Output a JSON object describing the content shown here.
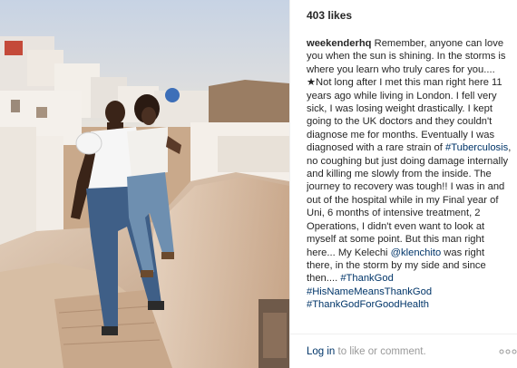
{
  "post": {
    "likes": "403 likes",
    "caption": {
      "username": "weekenderhq",
      "text_part1": "Remember, anyone can love you when the sun is shining. In the storms is where you learn who truly cares for you.... ",
      "star_glyph": "★",
      "text_part2": "Not long after I met this man right here 11 years ago while living in London. I fell very sick, I was losing weight drastically. I kept going to the UK doctors and they couldn't diagnose me for months. Eventually I was diagnosed with a rare strain of ",
      "hashtag_tb": "#Tuberculosis",
      "text_part3": ", no coughing but just doing damage internally and killing me slowly from the inside. The journey to recovery was tough!! I was in and out of the hospital while in my Final year of Uni, 6 months of intensive treatment, 2 Operations, I didn't even want to look at myself at some point. But this man right here... My Kelechi ",
      "mention": "@klenchito",
      "text_part4": " was right there, in the storm by my side and since then.... ",
      "hashtag_1": "#ThankGod",
      "hashtag_2": "#HisNameMeansThankGod",
      "hashtag_3": "#ThankGodForGoodHealth"
    },
    "footer": {
      "login_label": "Log in",
      "rest_label": " to like or comment."
    },
    "more_icon": "three-dots-icon"
  },
  "colors": {
    "text": "#262626",
    "link": "#003569",
    "muted": "#999999",
    "divider": "#efefef"
  }
}
